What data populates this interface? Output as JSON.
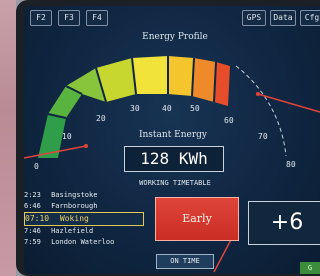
{
  "softkeys": {
    "f2": "F2",
    "f3": "F3",
    "f4": "F4",
    "gps": "GPS",
    "data": "Data",
    "cfg": "Cfg"
  },
  "gauge": {
    "title": "Energy Profile",
    "ticks": [
      "0",
      "10",
      "20",
      "30",
      "40",
      "50",
      "60",
      "70",
      "80"
    ],
    "band_colors": [
      "#2f9d4a",
      "#58b33f",
      "#89c53a",
      "#c8d72f",
      "#f1e33a",
      "#f5c52d",
      "#ef8a2a",
      "#e64d2a"
    ],
    "instant_energy_label": "Instant Energy",
    "instant_energy_value": "128 KWh"
  },
  "timetable": {
    "title": "WORKING TIMETABLE",
    "rows": [
      {
        "time": "2:23",
        "station": "Basingstoke"
      },
      {
        "time": "6:46",
        "station": "Farnborough"
      },
      {
        "time": "07:10",
        "station": "Woking"
      },
      {
        "time": "7:46",
        "station": "Hazlefield"
      },
      {
        "time": "7:59",
        "station": "London Waterloo"
      }
    ],
    "current_index": 2
  },
  "status": {
    "early_label": "Early",
    "on_time_label": "ON TIME",
    "delta": "+6",
    "indicator": "G"
  }
}
